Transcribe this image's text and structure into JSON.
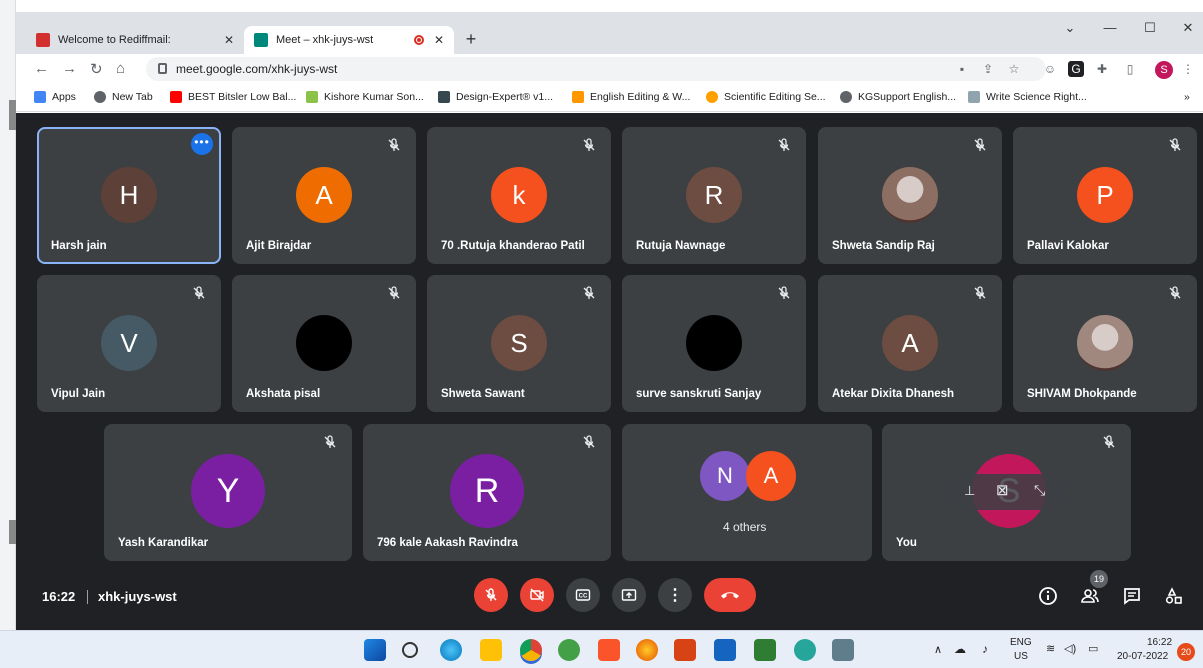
{
  "browser": {
    "tabs": [
      {
        "title": "Welcome to Rediffmail:",
        "favicon_color": "#d32f2f"
      },
      {
        "title": "Meet – xhk-juys-wst",
        "favicon_color": "#00897b"
      }
    ],
    "new_tab": "+",
    "window_controls": {
      "dropdown": "⌄",
      "minimize": "—",
      "maximize": "☐",
      "close": "✕"
    },
    "url": "meet.google.com/xhk-juys-wst",
    "profile_initial": "S",
    "bookmarks": [
      "Apps",
      "New Tab",
      "BEST Bitsler Low Bal...",
      "Kishore Kumar Son...",
      "Design-Expert® v1...",
      "English Editing & W...",
      "Scientific Editing Se...",
      "KGSupport English...",
      "Write Science Right..."
    ],
    "bookmarks_overflow": "»"
  },
  "meet": {
    "participants": [
      {
        "name": "Harsh jain",
        "initial": "H",
        "color": "#5d4037",
        "muted": false,
        "selected": true
      },
      {
        "name": "Ajit Birajdar",
        "initial": "A",
        "color": "#ef6c00",
        "muted": true
      },
      {
        "name": "70 .Rutuja khanderao Patil",
        "initial": "k",
        "color": "#f4511e",
        "muted": true
      },
      {
        "name": "Rutuja Nawnage",
        "initial": "R",
        "color": "#6d4c41",
        "muted": true
      },
      {
        "name": "Shweta Sandip Raj",
        "initial": "",
        "color": "#8d6e63",
        "muted": true,
        "photo": true
      },
      {
        "name": "Pallavi Kalokar",
        "initial": "P",
        "color": "#f4511e",
        "muted": true
      },
      {
        "name": "Vipul Jain",
        "initial": "V",
        "color": "#455a64",
        "muted": true
      },
      {
        "name": "Akshata pisal",
        "initial": "",
        "color": "#000000",
        "muted": true
      },
      {
        "name": "Shweta Sawant",
        "initial": "S",
        "color": "#6d4c41",
        "muted": true
      },
      {
        "name": "surve sanskruti Sanjay",
        "initial": "",
        "color": "#000000",
        "muted": true
      },
      {
        "name": "Atekar Dixita Dhanesh",
        "initial": "A",
        "color": "#6d4c41",
        "muted": true
      },
      {
        "name": "SHIVAM Dhokpande",
        "initial": "",
        "color": "#a1887f",
        "muted": true,
        "photo": true
      }
    ],
    "bottom_row": [
      {
        "name": "Yash Karandikar",
        "initial": "Y",
        "color": "#7b1fa2"
      },
      {
        "name": "796 kale Aakash Ravindra",
        "initial": "R",
        "color": "#7b1fa2"
      }
    ],
    "others": {
      "label": "4 others",
      "initials": [
        "N",
        "A"
      ],
      "colors": [
        "#7e57c2",
        "#f4511e"
      ]
    },
    "self_tile": {
      "name": "You",
      "initial": "S",
      "color": "#c2185b"
    },
    "more_options": "•••",
    "time": "16:22",
    "separator": "|",
    "meeting_code": "xhk-juys-wst",
    "people_count": "19"
  },
  "taskbar": {
    "lang_line1": "ENG",
    "lang_line2": "US",
    "time": "16:22",
    "date": "20-07-2022",
    "notifications": "20"
  }
}
